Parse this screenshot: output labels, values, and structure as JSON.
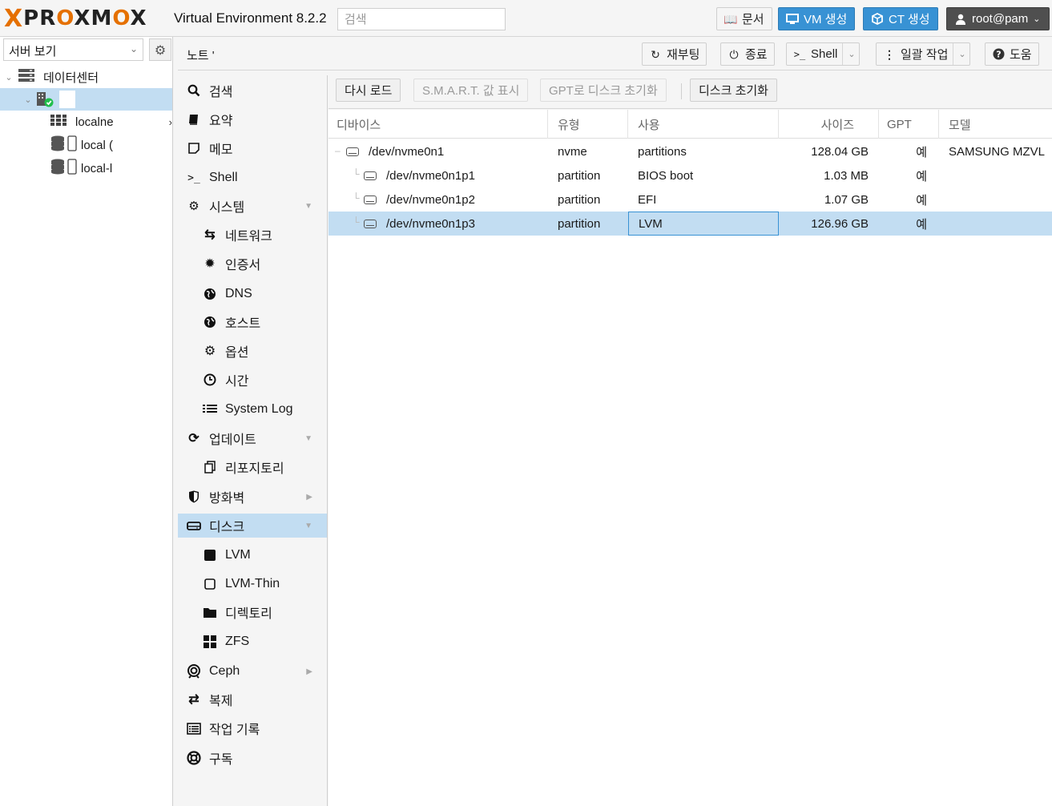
{
  "topbar": {
    "logo_x": "X",
    "logo_text": "PROXMOX",
    "version": "Virtual Environment 8.2.2",
    "search_placeholder": "검색",
    "docs_label": "문서",
    "create_vm_label": "VM 생성",
    "create_ct_label": "CT 생성",
    "user_label": "root@pam"
  },
  "tree": {
    "view_selector": "서버 보기",
    "datacenter_label": "데이터센터",
    "node_label": "",
    "children": [
      {
        "label": "localne",
        "icon": "grid-icon"
      },
      {
        "label": "local (",
        "icon": "storage-icon"
      },
      {
        "label": "local-l",
        "icon": "storage-icon"
      }
    ]
  },
  "nodebar": {
    "title": "노트 '",
    "reboot_label": "재부팅",
    "shutdown_label": "종료",
    "shell_label": "Shell",
    "bulk_label": "일괄 작업",
    "help_label": "도움"
  },
  "nav": {
    "items": [
      {
        "label": "검색",
        "icon": "search-icon",
        "indent": false
      },
      {
        "label": "요약",
        "icon": "book-icon",
        "indent": false
      },
      {
        "label": "메모",
        "icon": "note-icon",
        "indent": false
      },
      {
        "label": "Shell",
        "icon": "terminal-icon",
        "indent": false
      },
      {
        "label": "시스템",
        "icon": "cogs-icon",
        "indent": false,
        "expander": "down"
      },
      {
        "label": "네트워크",
        "icon": "exchange-icon",
        "indent": true
      },
      {
        "label": "인증서",
        "icon": "certificate-icon",
        "indent": true
      },
      {
        "label": "DNS",
        "icon": "globe-icon",
        "indent": true
      },
      {
        "label": "호스트",
        "icon": "globe-icon",
        "indent": true
      },
      {
        "label": "옵션",
        "icon": "gear-icon",
        "indent": true
      },
      {
        "label": "시간",
        "icon": "clock-icon",
        "indent": true
      },
      {
        "label": "System Log",
        "icon": "list-icon",
        "indent": true
      },
      {
        "label": "업데이트",
        "icon": "refresh-icon",
        "indent": false,
        "expander": "down"
      },
      {
        "label": "리포지토리",
        "icon": "files-icon",
        "indent": true
      },
      {
        "label": "방화벽",
        "icon": "shield-icon",
        "indent": false,
        "expander": "right"
      },
      {
        "label": "디스크",
        "icon": "hdd-icon",
        "indent": false,
        "expander": "down",
        "selected": true
      },
      {
        "label": "LVM",
        "icon": "square-icon",
        "indent": true
      },
      {
        "label": "LVM-Thin",
        "icon": "square-outline-icon",
        "indent": true
      },
      {
        "label": "디렉토리",
        "icon": "folder-icon",
        "indent": true
      },
      {
        "label": "ZFS",
        "icon": "th-large-icon",
        "indent": true
      },
      {
        "label": "Ceph",
        "icon": "ceph-icon",
        "indent": false,
        "expander": "right"
      },
      {
        "label": "복제",
        "icon": "retweet-icon",
        "indent": false
      },
      {
        "label": "작업 기록",
        "icon": "list-alt-icon",
        "indent": false
      },
      {
        "label": "구독",
        "icon": "support-icon",
        "indent": false
      }
    ]
  },
  "content_toolbar": {
    "reload_label": "다시 로드",
    "smart_label": "S.M.A.R.T. 값 표시",
    "gpt_init_label": "GPT로 디스크 초기화",
    "wipe_label": "디스크 초기화"
  },
  "grid": {
    "columns": [
      "디바이스",
      "유형",
      "사용",
      "사이즈",
      "GPT",
      "모델"
    ],
    "rows": [
      {
        "device": "/dev/nvme0n1",
        "type": "nvme",
        "usage": "partitions",
        "size": "128.04 GB",
        "gpt": "예",
        "model": "SAMSUNG MZVL",
        "level": 0
      },
      {
        "device": "/dev/nvme0n1p1",
        "type": "partition",
        "usage": "BIOS boot",
        "size": "1.03 MB",
        "gpt": "예",
        "model": "",
        "level": 1
      },
      {
        "device": "/dev/nvme0n1p2",
        "type": "partition",
        "usage": "EFI",
        "size": "1.07 GB",
        "gpt": "예",
        "model": "",
        "level": 1
      },
      {
        "device": "/dev/nvme0n1p3",
        "type": "partition",
        "usage": "LVM",
        "size": "126.96 GB",
        "gpt": "예",
        "model": "",
        "level": 1,
        "selected": true
      }
    ]
  },
  "colors": {
    "accent_orange": "#e57000",
    "button_blue": "#3892d4",
    "selection": "#c2ddf2"
  }
}
